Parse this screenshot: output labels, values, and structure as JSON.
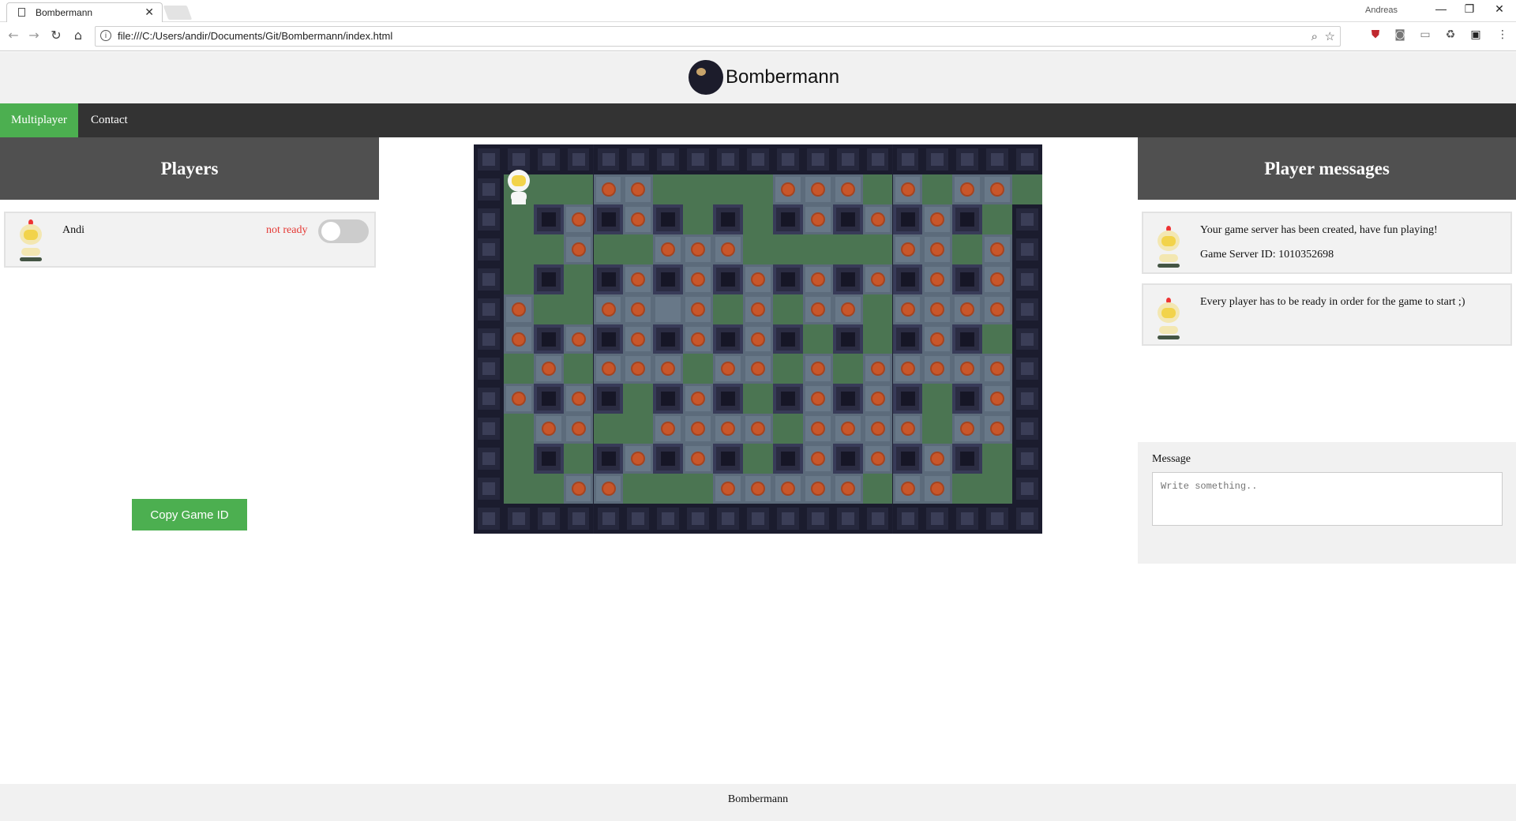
{
  "browser": {
    "tab_title": "Bombermann",
    "user": "Andreas",
    "url": "file:///C:/Users/andir/Documents/Git/Bombermann/index.html"
  },
  "header": {
    "brand": "Bombermann"
  },
  "nav": {
    "items": [
      "Multiplayer",
      "Contact"
    ]
  },
  "players": {
    "title": "Players",
    "list": [
      {
        "name": "Andi",
        "status": "not ready",
        "ready": false
      }
    ],
    "copy_button": "Copy Game ID"
  },
  "messages": {
    "title": "Player messages",
    "items": [
      {
        "lines": [
          "Your game server has been created, have fun playing!",
          "Game Server ID: 1010352698"
        ]
      },
      {
        "lines": [
          "Every player has to be ready in order for the game to start ;)"
        ]
      }
    ],
    "composer_label": "Message",
    "composer_placeholder": "Write something.."
  },
  "board": {
    "cols": 19,
    "rows": 13,
    "legend": "W=outer wall, P=pillar, G=grass, C=crate, B=crate with bomb-item, H=player",
    "map": [
      "WWWWWWWWWWWWWWWWWWW",
      "WHGGBBGGGGBBBGBGBBGGW",
      "WGPBPBPGPGPBPBPBPGW",
      "WGGBGGBBBGGGGGBBGBW",
      "WGPGPBPBPBPBPBPBPBW",
      "WBGGBBCBGBGBBGBBBBW",
      "WBPBPBPBPBPGPGPBPGW",
      "WGBGBBBGBBGBGBBBBBW",
      "WBPBPGPBPGPBPBPGPBW",
      "WGBBGGBBBBGBBBBGBBW",
      "WGPGPBPBPGPBPBPBPGW",
      "WGGBBGGGBBBBBGBBGGW",
      "WWWWWWWWWWWWWWWWWWW"
    ]
  },
  "footer": {
    "text": "Bombermann"
  }
}
